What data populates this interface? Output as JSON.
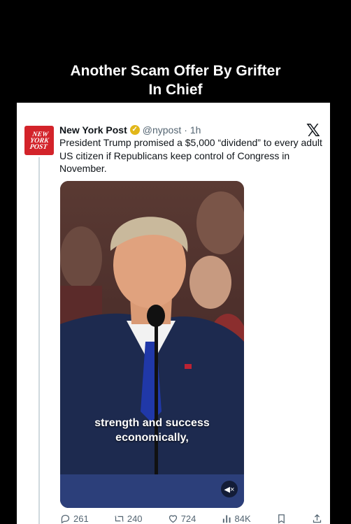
{
  "overlay": {
    "caption_line1": "Another Scam Offer By Grifter",
    "caption_line2": "In Chief"
  },
  "tweet": {
    "author_name": "New York Post",
    "avatar_text": [
      "NEW",
      "YORK",
      "POST"
    ],
    "handle": "@nypost",
    "separator": "·",
    "time": "1h",
    "platform_logo": "𝕏",
    "text": "President Trump promised a $5,000 “dividend” to every adult US citizen if Republicans keep control of Congress in November."
  },
  "media": {
    "subtitle_line1": "strength and success",
    "subtitle_line2": "economically,",
    "mute_icon": "🔇"
  },
  "actions": {
    "replies": "261",
    "reposts": "240",
    "likes": "724",
    "views": "84K"
  },
  "colors": {
    "brand_red": "#d3232a",
    "verified_gold": "#e2b719",
    "secondary_text": "#536471"
  }
}
